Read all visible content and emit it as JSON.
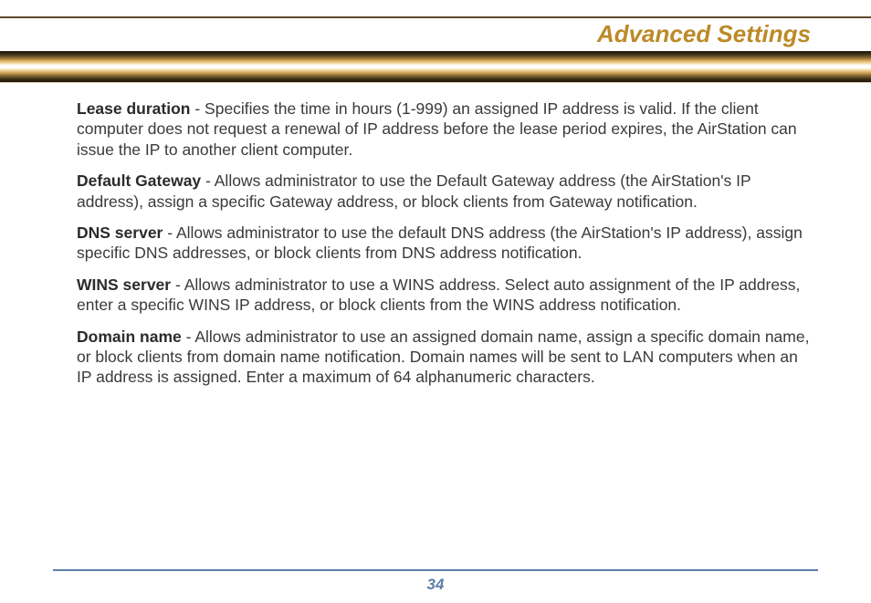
{
  "title": "Advanced Settings",
  "pageNumber": "34",
  "definitions": [
    {
      "term": "Lease duration",
      "desc": " - Specifies the time in hours (1-999) an assigned IP address is valid. If the client computer does not request a renewal of IP address before the lease period expires, the AirStation can issue the IP to another client computer."
    },
    {
      "term": "Default Gateway ",
      "desc": " - Allows administrator to use the Default Gateway address (the AirStation's IP address), assign a specific Gateway address, or block clients from Gateway notification."
    },
    {
      "term": "DNS server",
      "desc": " - Allows administrator to use the default DNS address (the AirStation's IP address), assign specific DNS addresses, or block clients from DNS address notification."
    },
    {
      "term": "WINS server",
      "desc": " - Allows administrator to use a WINS address.  Select auto assignment of the IP ad­dress, enter a specific WINS IP address, or block clients from the WINS address notification."
    },
    {
      "term": "Domain name",
      "desc": " - Allows administrator to use an assigned domain name, assign a specific domain name, or block clients from domain name notification.  Domain names will be sent to LAN comput­ers when an IP address is assigned.  Enter a maximum of 64 alphanumeric characters."
    }
  ]
}
